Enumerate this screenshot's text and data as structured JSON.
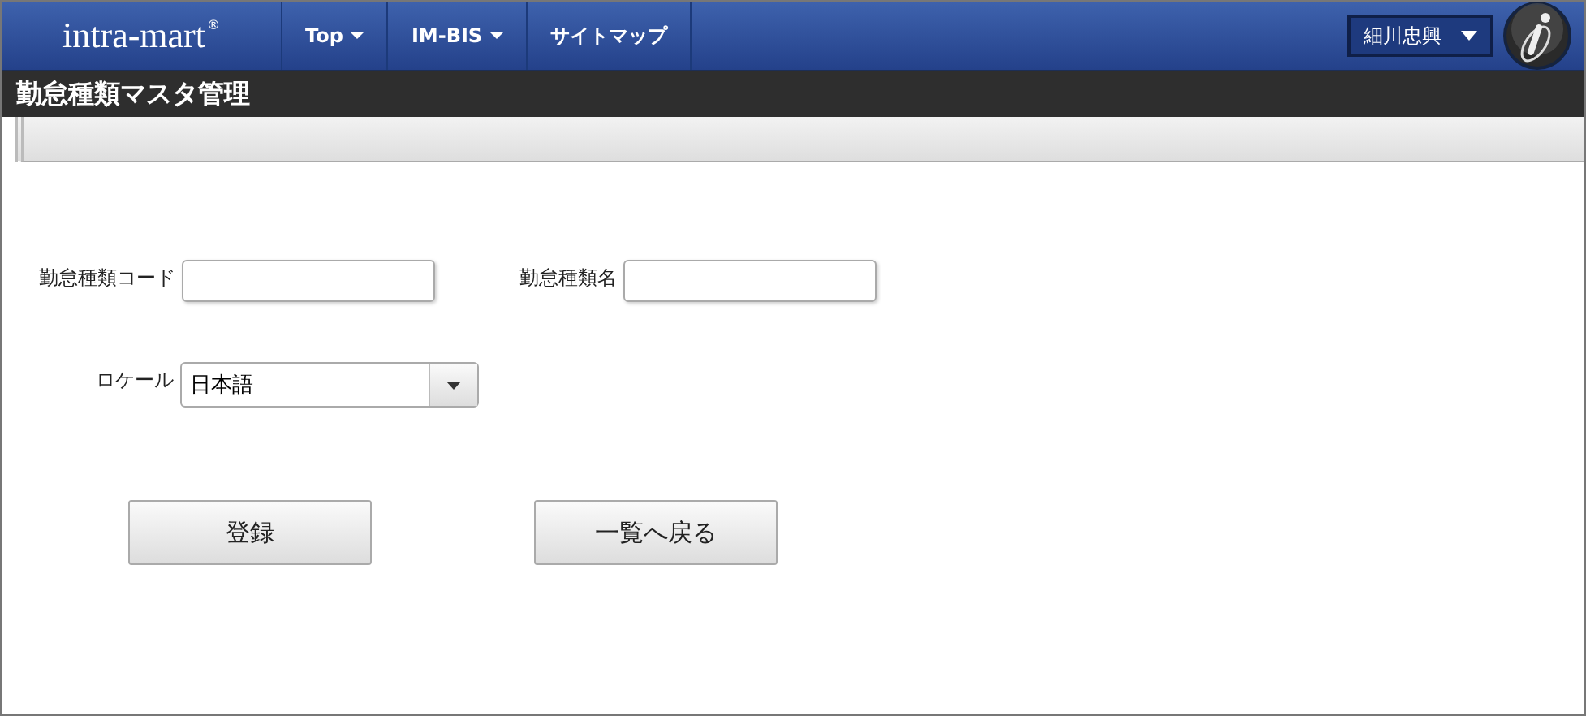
{
  "header": {
    "logo": "intra-mart",
    "logo_mark": "®",
    "menu": [
      {
        "label": "Top",
        "has_dropdown": true
      },
      {
        "label": "IM-BIS",
        "has_dropdown": true
      },
      {
        "label": "サイトマップ",
        "has_dropdown": false
      }
    ],
    "user": "細川忠興"
  },
  "page_title": "勤怠種類マスタ管理",
  "form": {
    "code_label": "勤怠種類コード",
    "name_label": "勤怠種類名",
    "locale_label": "ロケール",
    "locale_value": "日本語"
  },
  "buttons": [
    "登録",
    "一覧へ戻る"
  ]
}
